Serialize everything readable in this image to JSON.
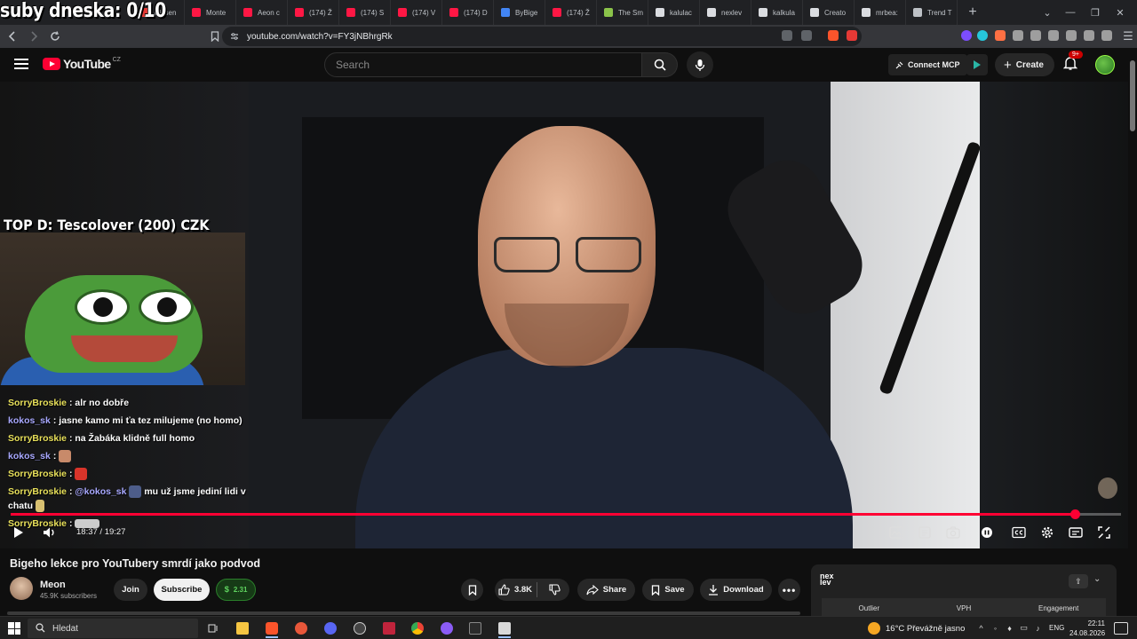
{
  "stream_overlay": {
    "goal_text": "suby dneska: 0/10",
    "top_donor": "TOP D: Tescolover (200) CZK"
  },
  "browser": {
    "tabs": [
      {
        "label": "klkisen",
        "color": "#e53935"
      },
      {
        "label": "Monte",
        "color": "#ff1744"
      },
      {
        "label": "Aeon c",
        "color": "#ff1744"
      },
      {
        "label": "(174) Ž",
        "color": "#ff1744"
      },
      {
        "label": "(174) S",
        "color": "#ff1744"
      },
      {
        "label": "(174) V",
        "color": "#ff1744"
      },
      {
        "label": "(174) D",
        "color": "#ff1744"
      },
      {
        "label": "ByBige",
        "color": "#4285f4"
      },
      {
        "label": "(174) Ž",
        "color": "#ff1744"
      },
      {
        "label": "The Sm",
        "color": "#8bc34a"
      },
      {
        "label": "kalulac",
        "color": "#dadce0"
      },
      {
        "label": "nexlev",
        "color": "#dadce0"
      },
      {
        "label": "kalkula",
        "color": "#dadce0"
      },
      {
        "label": "Creato",
        "color": "#dadce0"
      },
      {
        "label": "mrbea:",
        "color": "#dadce0"
      },
      {
        "label": "Trend T",
        "color": "#bdc1c6"
      }
    ],
    "url": "youtube.com/watch?v=FY3jNBhrgRk"
  },
  "masthead": {
    "logo_text": "YouTube",
    "country_code": "CZ",
    "search_placeholder": "Search",
    "connect_mcp_label": "Connect MCP",
    "create_label": "Create",
    "notification_badge": "9+"
  },
  "player": {
    "current_time": "18:37",
    "duration": "19:27",
    "time_display": "18:37 / 19:27",
    "progress_fraction": 0.958
  },
  "chat": {
    "messages": [
      {
        "user": "SorryBroskie",
        "user_color": "#e8e05a",
        "text": ": alr no dobře"
      },
      {
        "user": "kokos_sk",
        "user_color": "#a8a8ff",
        "text": ": jasne kamo mi ťa tez milujeme (no homo)"
      },
      {
        "user": "SorryBroskie",
        "user_color": "#e8e05a",
        "text": ": na Žabáka klidně full homo"
      },
      {
        "user": "kokos_sk",
        "user_color": "#a8a8ff",
        "text": ":"
      },
      {
        "user": "SorryBroskie",
        "user_color": "#e8e05a",
        "text": ":"
      },
      {
        "user": "SorryBroskie",
        "user_color": "#e8e05a",
        "mention": "@kokos_sk",
        "text": "mu už jsme jediní lidi v chatu"
      },
      {
        "user": "SorryBroskie",
        "user_color": "#e8e05a",
        "text": ":"
      }
    ]
  },
  "video": {
    "title": "Bigeho lekce pro YouTubery smrdí jako podvod",
    "channel_name": "Meon",
    "subscribers": "45.9K subscribers",
    "join_label": "Join",
    "subscribe_label": "Subscribe",
    "thanks_amount": "2.31",
    "like_count": "3.8K",
    "share_label": "Share",
    "save_label": "Save",
    "download_label": "Download"
  },
  "extension_panel": {
    "logo": "nex lev",
    "columns": [
      "Outlier",
      "VPH",
      "Engagement"
    ]
  },
  "taskbar": {
    "search_placeholder": "Hledat",
    "weather": "16°C  Převážně jasno",
    "language": "ENG",
    "time": "22:11",
    "date": "24.08.2026"
  },
  "colors": {
    "youtube_red": "#ff0033",
    "progress_red": "#ff0033",
    "background": "#0f0f0f",
    "thanks_green": "#5fd35f"
  }
}
